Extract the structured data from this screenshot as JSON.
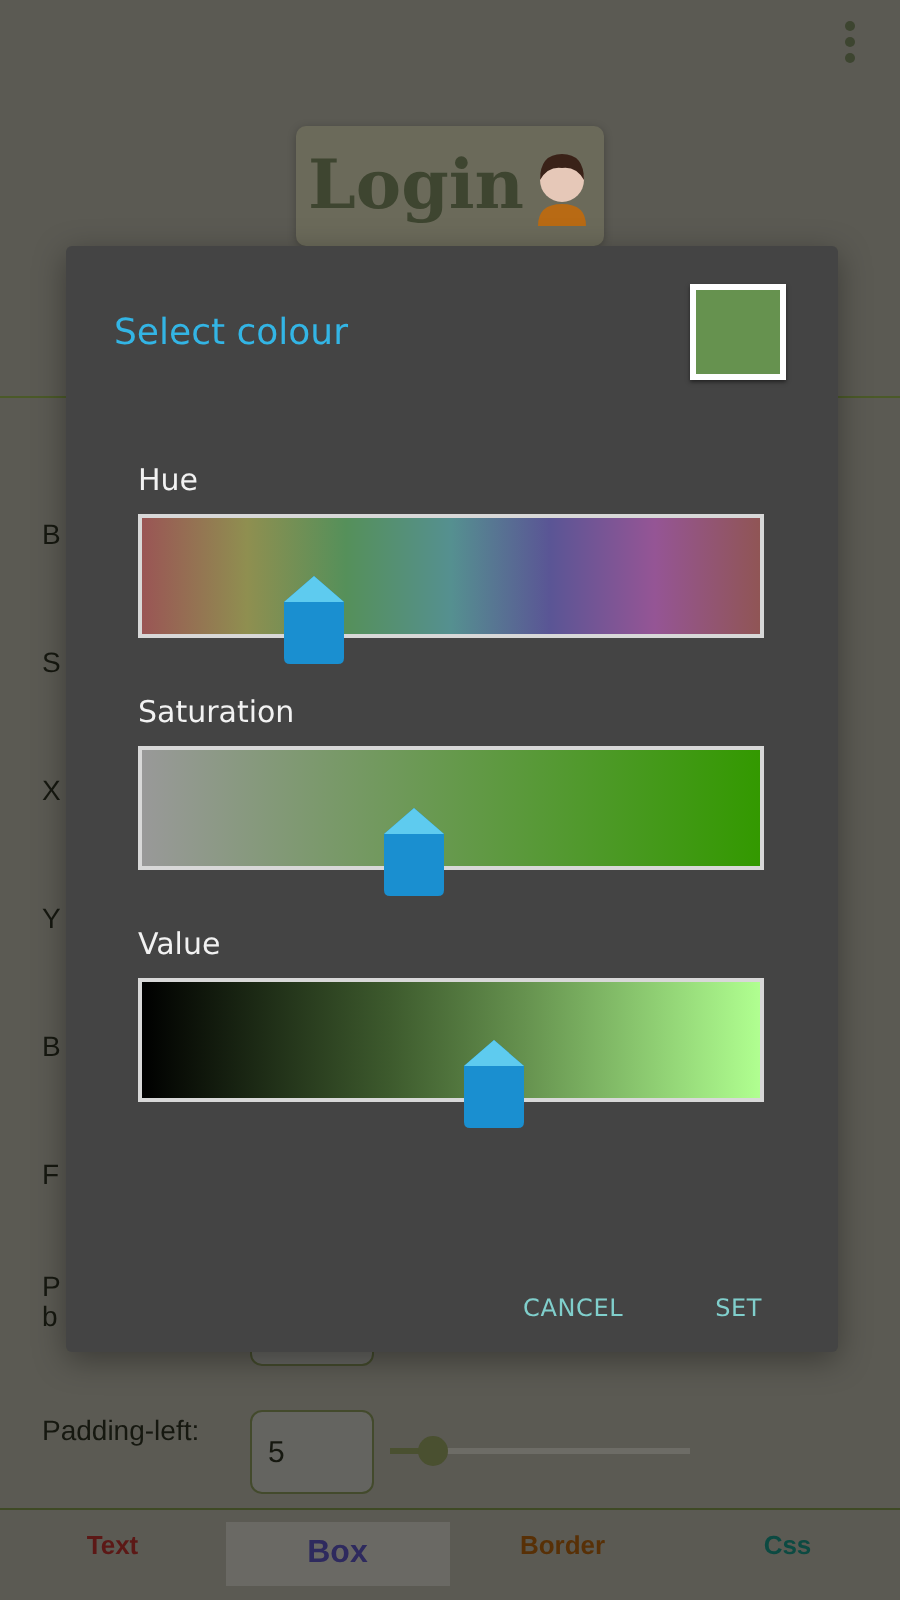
{
  "app_bar": {
    "title": "Login"
  },
  "form_rows": [
    {
      "kind": "label",
      "label_lines": [
        "B"
      ]
    },
    {
      "kind": "label",
      "label_lines": [
        "S"
      ]
    },
    {
      "kind": "label",
      "label_lines": [
        "X"
      ]
    },
    {
      "kind": "label",
      "label_lines": [
        "Y"
      ]
    },
    {
      "kind": "label",
      "label_lines": [
        "B"
      ]
    },
    {
      "kind": "label",
      "label_lines": [
        "F"
      ]
    },
    {
      "kind": "field",
      "label_lines": [
        "P",
        "b"
      ]
    },
    {
      "kind": "field",
      "label_lines": [
        "Padding-left:"
      ],
      "value": "5",
      "level": 0.12
    }
  ],
  "dialog": {
    "title": "Select colour",
    "sliders": [
      {
        "label": "Hue",
        "kind": "hue",
        "level": 0.28
      },
      {
        "label": "Saturation",
        "kind": "saturation",
        "level": 0.44
      },
      {
        "label": "Value",
        "kind": "value",
        "level": 0.57
      }
    ],
    "buttons": [
      "CANCEL",
      "SET"
    ]
  },
  "tabs": [
    {
      "label": "Text",
      "color": "#5c1816",
      "selected": false
    },
    {
      "label": "Box",
      "color": "#2e2a5e",
      "selected": true
    },
    {
      "label": "Border",
      "color": "#583006",
      "selected": false
    },
    {
      "label": "Css",
      "color": "#0c4a42",
      "selected": false
    }
  ]
}
